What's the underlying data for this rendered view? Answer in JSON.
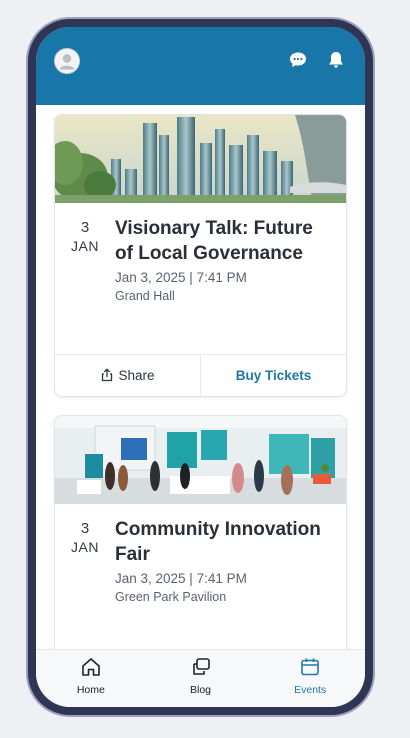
{
  "header": {
    "avatar_icon": "user-avatar-icon",
    "chat_icon": "chat-bubble-icon",
    "notifications_icon": "bell-icon",
    "background_color": "#1976a8"
  },
  "events": [
    {
      "day": "3",
      "month": "JAN",
      "title": "Visionary Talk: Future of Local Governance",
      "datetime": "Jan 3, 2025 | 7:41 PM",
      "venue": "Grand Hall",
      "image_icon": "futuristic-city-image",
      "share_label": "Share",
      "buy_label": "Buy Tickets"
    },
    {
      "day": "3",
      "month": "JAN",
      "title": "Community Innovation Fair",
      "datetime": "Jan 3, 2025 | 7:41 PM",
      "venue": "Green Park Pavilion",
      "image_icon": "expo-booth-image"
    }
  ],
  "nav": [
    {
      "label": "Home",
      "icon": "home-icon",
      "active": false
    },
    {
      "label": "Blog",
      "icon": "blog-icon",
      "active": false
    },
    {
      "label": "Events",
      "icon": "calendar-icon",
      "active": true
    }
  ],
  "colors": {
    "accent": "#1f78a8",
    "frame": "#2f3654"
  }
}
